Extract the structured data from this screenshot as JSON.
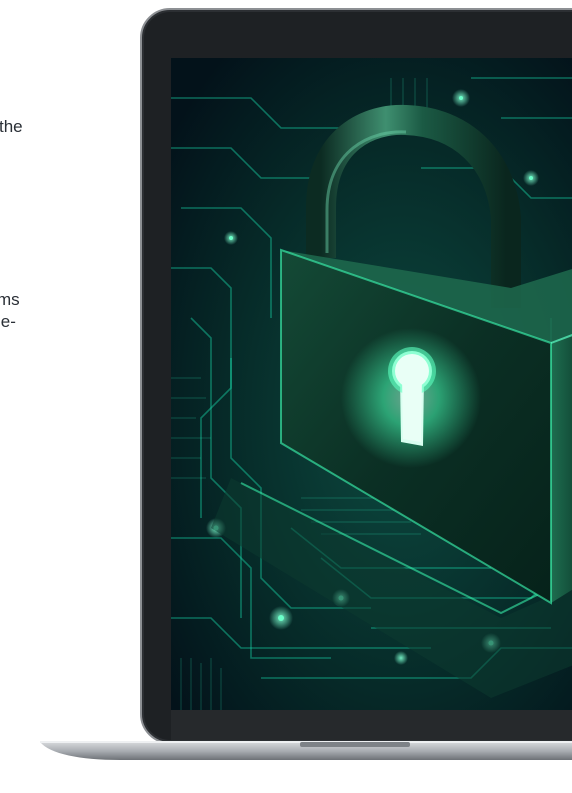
{
  "copy": {
    "line1": "the",
    "line2": "ms",
    "line3": "le-"
  },
  "illustration": {
    "subject": "padlock-on-circuit-board",
    "colors": {
      "glow": "#39ffb0",
      "lock_body": "#0f3a2c",
      "background": "#04151a",
      "circuit": "#19d6a8"
    }
  }
}
